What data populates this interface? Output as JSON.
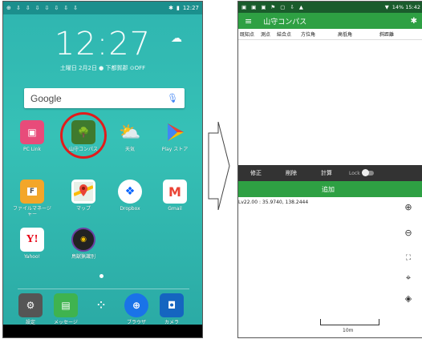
{
  "left_phone": {
    "status_time": "12:27",
    "clock": "12:27",
    "date_line": "土曜日 2月2日 ● 下都賀郡 ⊙OFF",
    "search": {
      "logo": "Google"
    },
    "apps_row1": [
      {
        "label": "PC Link",
        "icon": "pc-link-icon",
        "color": "#e84b7a"
      },
      {
        "label": "山守コンパス",
        "icon": "compass-app-icon",
        "color": "#3f7a2e"
      },
      {
        "label": "天気",
        "icon": "weather-icon",
        "color": "#f5b400"
      },
      {
        "label": "Play ストア",
        "icon": "play-store-icon",
        "color": "#ffffff"
      }
    ],
    "apps_row2": [
      {
        "label": "ファイルマネージャー",
        "icon": "folder-icon",
        "color": "#f3a629"
      },
      {
        "label": "マップ",
        "icon": "maps-icon",
        "color": "#ffffff"
      },
      {
        "label": "Dropbox",
        "icon": "dropbox-icon",
        "color": "#ffffff"
      },
      {
        "label": "Gmail",
        "icon": "gmail-icon",
        "color": "#ffffff"
      }
    ],
    "apps_row3": [
      {
        "label": "Yahoo!",
        "icon": "yahoo-icon",
        "color": "#ffffff"
      },
      {
        "label": "鳥獣猟識別",
        "icon": "hunting-app-icon",
        "color": "#222222"
      }
    ],
    "dock": [
      {
        "label": "設定",
        "icon": "settings-icon",
        "color": "#555555"
      },
      {
        "label": "メッセージ",
        "icon": "messages-icon",
        "color": "#3fb34f"
      },
      {
        "label": "",
        "icon": "app-drawer-icon",
        "color": "transparent"
      },
      {
        "label": "ブラウザ",
        "icon": "browser-icon",
        "color": "#1a73e8"
      },
      {
        "label": "カメラ",
        "icon": "camera-icon",
        "color": "#1565c0"
      }
    ]
  },
  "right_phone": {
    "status_time": "14% 15:42",
    "app_title": "山守コンパス",
    "columns": [
      "既知点",
      "測点",
      "結合点",
      "方位角",
      "高低角",
      "斜距離"
    ],
    "controls": {
      "edit": "修正",
      "delete": "削除",
      "calc": "計算",
      "lock": "Lock"
    },
    "add_label": "追加",
    "coords": "Lv22.00 : 35.9740, 138.2444",
    "scale_label": "10m"
  },
  "colors": {
    "accent_green": "#2ea043",
    "highlight_red": "#e21b1b",
    "teal_bg": "#2fb5b0"
  }
}
